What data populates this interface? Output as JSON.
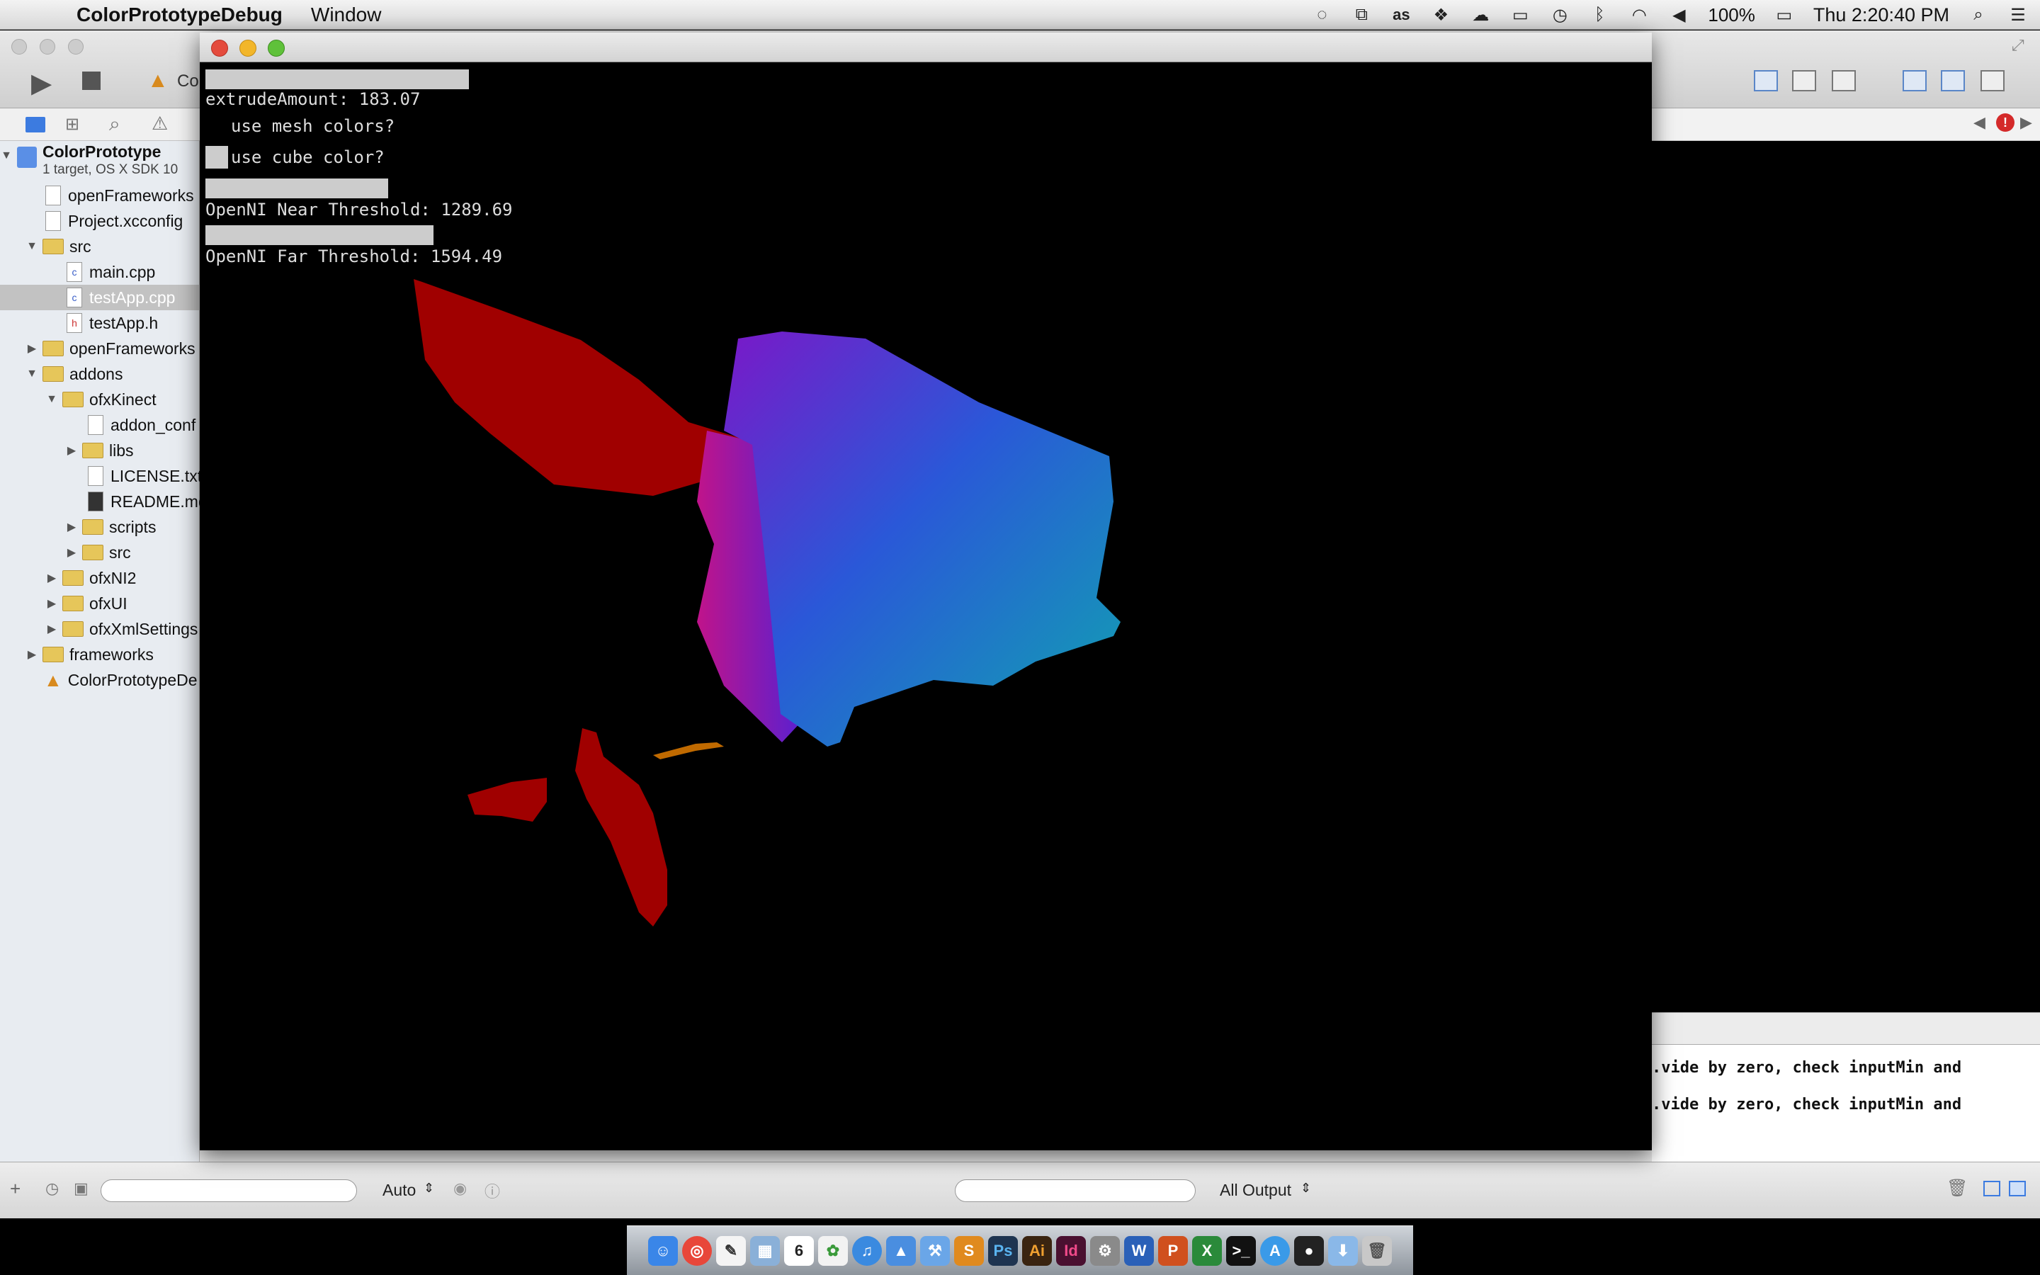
{
  "menubar": {
    "app_name": "ColorPrototypeDebug",
    "menu_window": "Window",
    "battery": "100%",
    "clock": "Thu 2:20:40 PM"
  },
  "toolbar": {
    "scheme_fragment": "Co"
  },
  "navigator": {
    "project_name": "ColorPrototype",
    "project_sub": "1 target, OS X SDK 10",
    "items": [
      {
        "label": "openFrameworks"
      },
      {
        "label": "Project.xcconfig"
      },
      {
        "label": "src"
      },
      {
        "label": "main.cpp"
      },
      {
        "label": "testApp.cpp"
      },
      {
        "label": "testApp.h"
      },
      {
        "label": "openFrameworks"
      },
      {
        "label": "addons"
      },
      {
        "label": "ofxKinect"
      },
      {
        "label": "addon_conf"
      },
      {
        "label": "libs"
      },
      {
        "label": "LICENSE.txt"
      },
      {
        "label": "README.md"
      },
      {
        "label": "scripts"
      },
      {
        "label": "src"
      },
      {
        "label": "ofxNI2"
      },
      {
        "label": "ofxUI"
      },
      {
        "label": "ofxXmlSettings"
      },
      {
        "label": "frameworks"
      },
      {
        "label": "ColorPrototypeDe"
      }
    ]
  },
  "gui": {
    "extrude": "extrudeAmount: 183.07",
    "mesh_colors": "use mesh colors?",
    "cube_color": "use cube color?",
    "near": "OpenNI Near Threshold: 1289.69",
    "far": "OpenNI Far Threshold: 1594.49"
  },
  "console": {
    "line1": ".vide by zero, check inputMin and",
    "line2": ".vide by zero, check inputMin and"
  },
  "bottombar": {
    "auto_label": "Auto",
    "output_label": "All Output"
  },
  "colors": {
    "red_mesh": "#a00000",
    "cube_purple": "#6a1bd6",
    "cube_teal": "#12a8a8"
  }
}
